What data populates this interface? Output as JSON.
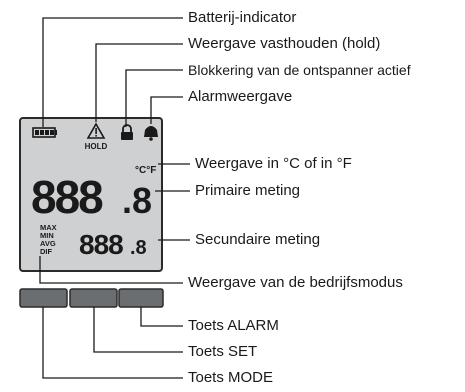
{
  "labels": {
    "battery": "Batterij-indicator",
    "hold": "Weergave vasthouden (hold)",
    "trigger_lock": "Blokkering van de ontspanner actief",
    "alarm": "Alarmweergave",
    "unit": "Weergave in °C of in °F",
    "primary": "Primaire meting",
    "secondary": "Secundaire meting",
    "mode": "Weergave van de bedrijfsmodus",
    "key_alarm": "Toets ALARM",
    "key_set": "Toets SET",
    "key_mode": "Toets MODE"
  },
  "lcd": {
    "hold_text": "HOLD",
    "unit_text": "°C°F",
    "primary_digits": "888",
    "primary_decimal": ".8",
    "secondary_digits": "888",
    "secondary_decimal": ".8",
    "modes": [
      "MAX",
      "MIN",
      "AVG",
      "DIF"
    ]
  },
  "colors": {
    "lcd_bg": "#cfd0d2",
    "lcd_border": "#2a2a2a",
    "button_fill": "#6b6e71",
    "line": "#1a1a1a"
  }
}
